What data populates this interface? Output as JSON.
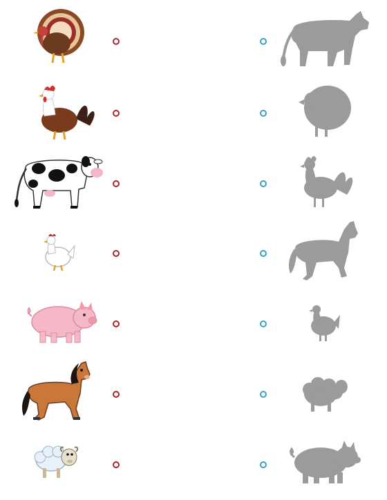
{
  "worksheet": {
    "colors": {
      "left_dot": "#a5262e",
      "right_dot": "#3aa0c8",
      "silhouette": "#9b9b9b"
    },
    "left_column": [
      {
        "icon": "turkey-icon"
      },
      {
        "icon": "rooster-icon"
      },
      {
        "icon": "cow-icon"
      },
      {
        "icon": "hen-icon"
      },
      {
        "icon": "pig-icon"
      },
      {
        "icon": "horse-icon"
      },
      {
        "icon": "sheep-icon"
      }
    ],
    "right_column": [
      {
        "icon": "cow-silhouette-icon"
      },
      {
        "icon": "turkey-silhouette-icon"
      },
      {
        "icon": "rooster-silhouette-icon"
      },
      {
        "icon": "horse-silhouette-icon"
      },
      {
        "icon": "hen-silhouette-icon"
      },
      {
        "icon": "sheep-silhouette-icon"
      },
      {
        "icon": "pig-silhouette-icon"
      }
    ]
  }
}
